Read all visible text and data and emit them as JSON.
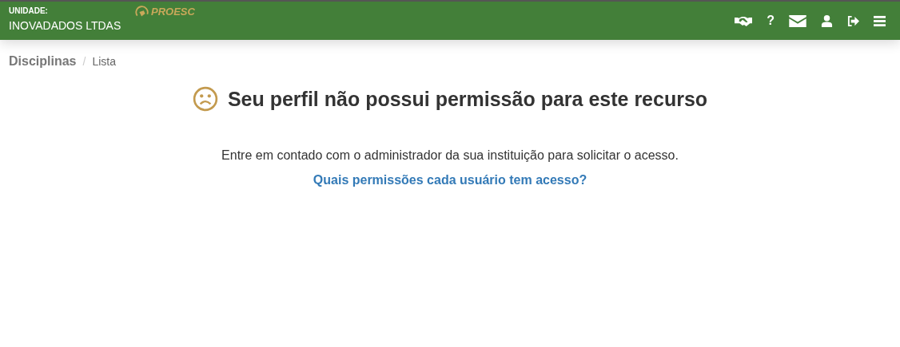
{
  "header": {
    "unit_label": "UNIDADE:",
    "unit_name": "INOVADADOS LTDAS",
    "logo_text": "PROESC",
    "actions": [
      {
        "kind": "handshake"
      },
      {
        "kind": "help",
        "glyph": "?"
      },
      {
        "kind": "mail"
      },
      {
        "kind": "user"
      },
      {
        "kind": "logout"
      },
      {
        "kind": "menu"
      }
    ]
  },
  "breadcrumb_separator": "/",
  "breadcrumb": [
    {
      "label": "Disciplinas",
      "selected": false
    },
    {
      "label": "Lista",
      "selected": true
    }
  ],
  "message": {
    "title": "Seu perfil não possui permissão para este recurso",
    "body": "Entre em contado com o administrador da sua instituição para solicitar o acesso.",
    "link": "Quais permissões cada usuário tem acesso?"
  }
}
